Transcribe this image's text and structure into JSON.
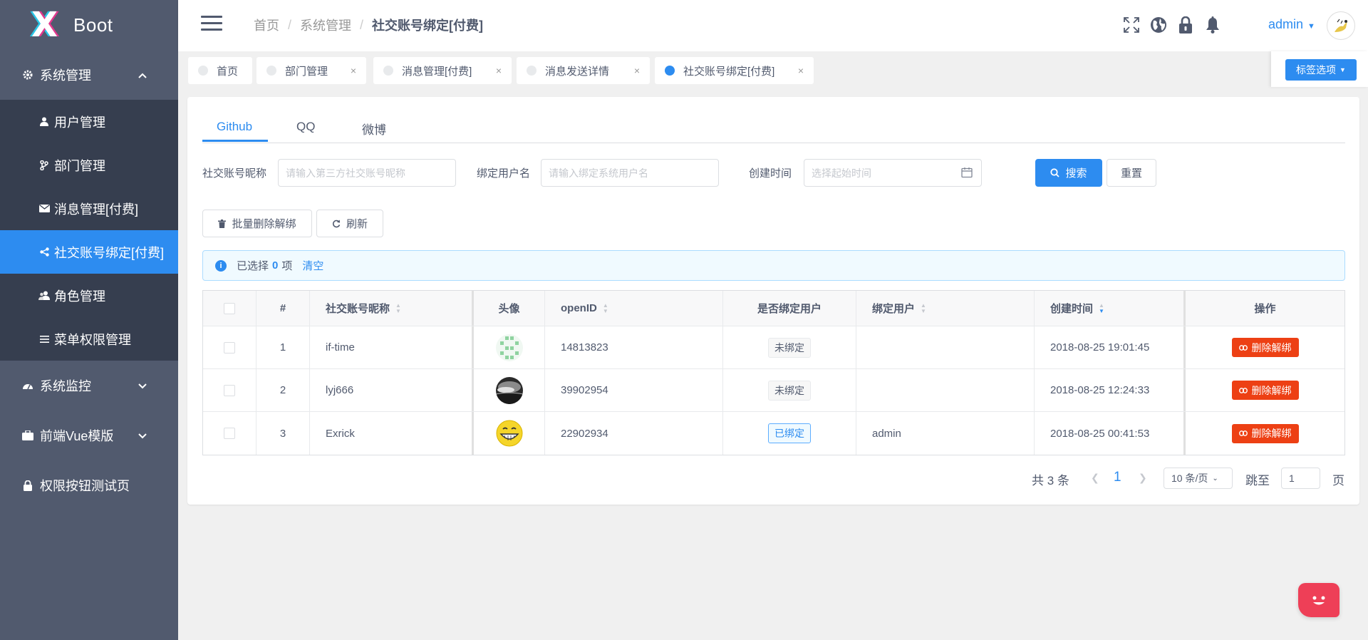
{
  "app": {
    "logo_mark": "X",
    "logo_text": "X Boot"
  },
  "sidebar": {
    "groups": [
      {
        "label": "系统管理",
        "icon": "gear-icon",
        "expanded": true
      },
      {
        "label": "系统监控",
        "icon": "dashboard-icon",
        "expanded": false
      },
      {
        "label": "前端Vue模版",
        "icon": "briefcase-icon",
        "expanded": false
      },
      {
        "label": "权限按钮测试页",
        "icon": "lock-icon",
        "expanded": false
      }
    ],
    "items": [
      {
        "label": "用户管理",
        "icon": "person-icon"
      },
      {
        "label": "部门管理",
        "icon": "branch-icon"
      },
      {
        "label": "消息管理[付费]",
        "icon": "mail-icon"
      },
      {
        "label": "社交账号绑定[付费]",
        "icon": "share-icon",
        "active": true
      },
      {
        "label": "角色管理",
        "icon": "people-icon"
      },
      {
        "label": "菜单权限管理",
        "icon": "menu-icon"
      }
    ]
  },
  "header": {
    "breadcrumb": [
      "首页",
      "系统管理",
      "社交账号绑定[付费]"
    ],
    "breadcrumb_sep": "/",
    "user": "admin"
  },
  "tags": {
    "items": [
      {
        "label": "首页",
        "closable": false
      },
      {
        "label": "部门管理",
        "closable": true
      },
      {
        "label": "消息管理[付费]",
        "closable": true
      },
      {
        "label": "消息发送详情",
        "closable": true
      },
      {
        "label": "社交账号绑定[付费]",
        "closable": true,
        "active": true
      }
    ],
    "close_glyph": "×",
    "options_label": "标签选项"
  },
  "tabs": [
    {
      "label": "Github",
      "active": true
    },
    {
      "label": "QQ"
    },
    {
      "label": "微博"
    }
  ],
  "search": {
    "nickname_label": "社交账号昵称",
    "nickname_placeholder": "请输入第三方社交账号昵称",
    "username_label": "绑定用户名",
    "username_placeholder": "请输入绑定系统用户名",
    "date_label": "创建时间",
    "date_placeholder": "选择起始时间",
    "search_button": "搜索",
    "reset_button": "重置"
  },
  "toolbar": {
    "batch_delete": "批量删除解绑",
    "refresh": "刷新"
  },
  "alert": {
    "prefix": "已选择",
    "count": "0",
    "suffix": "项",
    "clear": "清空"
  },
  "table": {
    "columns": [
      "#",
      "社交账号昵称",
      "头像",
      "openID",
      "是否绑定用户",
      "绑定用户",
      "创建时间",
      "操作"
    ],
    "rows": [
      {
        "index": "1",
        "nickname": "if-time",
        "avatar": "green-pattern",
        "openid": "14813823",
        "bound": "未绑定",
        "is_bound": false,
        "user": "",
        "created": "2018-08-25 19:01:45",
        "action": "删除解绑"
      },
      {
        "index": "2",
        "nickname": "lyj666",
        "avatar": "dark-landscape",
        "openid": "39902954",
        "bound": "未绑定",
        "is_bound": false,
        "user": "",
        "created": "2018-08-25 12:24:33",
        "action": "删除解绑"
      },
      {
        "index": "3",
        "nickname": "Exrick",
        "avatar": "yellow-smiley",
        "openid": "22902934",
        "bound": "已绑定",
        "is_bound": true,
        "user": "admin",
        "created": "2018-08-25 00:41:53",
        "action": "删除解绑"
      }
    ]
  },
  "pagination": {
    "total": "共 3 条",
    "current": "1",
    "page_size": "10 条/页",
    "jump_label": "跳至",
    "jump_value": "1",
    "page_suffix": "页"
  },
  "colors": {
    "primary": "#2d8cf0",
    "danger": "#ed4014",
    "sidebar": "#515a6e",
    "submenu": "#363e4f"
  }
}
